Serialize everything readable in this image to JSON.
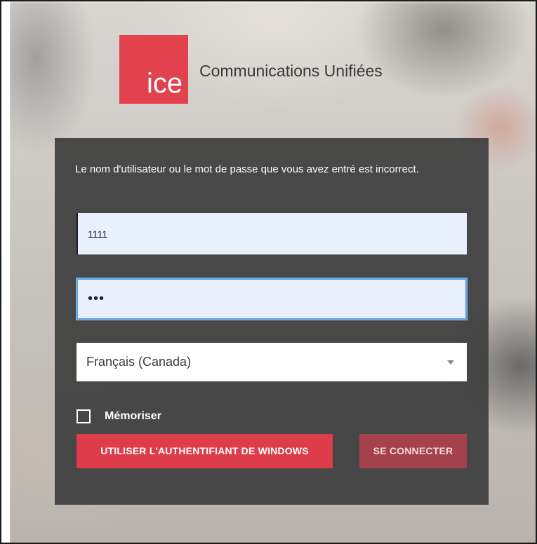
{
  "brand": {
    "logo_text": "ice",
    "name": "Communications Unifiées",
    "accent_color": "#e2424d"
  },
  "login": {
    "error_message": "Le nom d'utilisateur ou le mot de passe que vous avez entré est incorrect.",
    "username_value": "1111",
    "password_value": "•••",
    "language_selected": "Français (Canada)",
    "remember_label": "Mémoriser",
    "remember_checked": false,
    "windows_auth_label": "UTILISER L'AUTHENTIFIANT DE WINDOWS",
    "connect_label": "SE CONNECTER"
  }
}
